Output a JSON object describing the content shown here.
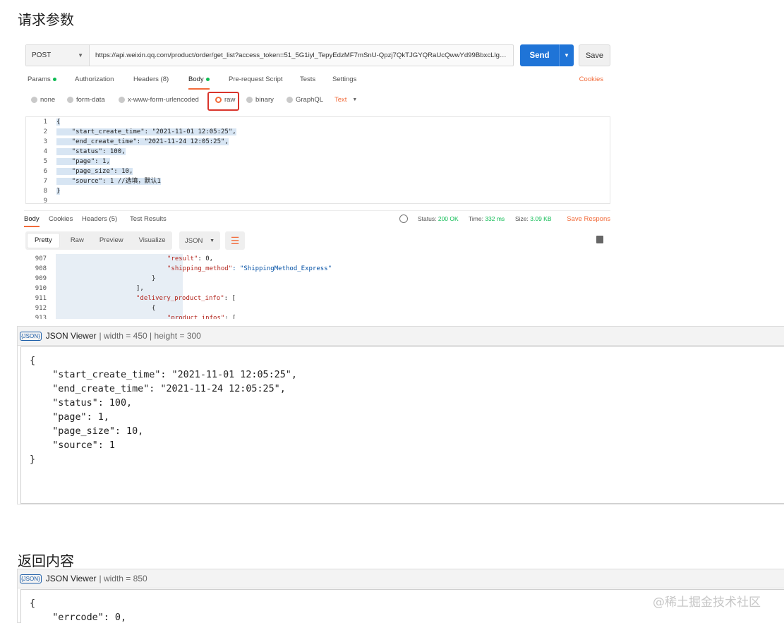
{
  "sections": {
    "request_title": "请求参数",
    "response_title": "返回内容"
  },
  "postman": {
    "method": "POST",
    "url": "https://api.weixin.qq.com/product/order/get_list?access_token=51_5G1iyl_TepyEdzMF7mSnU-Qpzj7QkTJGYQRaUcQwwYd99BbxcLlgV ...",
    "send_label": "Send",
    "save_label": "Save",
    "request_tabs": [
      "Params",
      "Authorization",
      "Headers (8)",
      "Body",
      "Pre-request Script",
      "Tests",
      "Settings"
    ],
    "cookies_label": "Cookies",
    "body_options": [
      "none",
      "form-data",
      "x-www-form-urlencoded",
      "raw",
      "binary",
      "GraphQL"
    ],
    "body_format": "Text",
    "editor_lines": [
      "{",
      "    \"start_create_time\": \"2021-11-01 12:05:25\",",
      "    \"end_create_time\": \"2021-11-24 12:05:25\",",
      "    \"status\": 100,",
      "    \"page\": 1,",
      "    \"page_size\": 10,",
      "    \"source\": 1 //选填，默认1",
      "}",
      ""
    ],
    "editor_line_numbers": [
      "1",
      "2",
      "3",
      "4",
      "5",
      "6",
      "7",
      "8",
      "9"
    ],
    "response_tabs": [
      "Body",
      "Cookies",
      "Headers (5)",
      "Test Results"
    ],
    "status_label": "Status:",
    "status_value": "200 OK",
    "time_label": "Time:",
    "time_value": "332 ms",
    "size_label": "Size:",
    "size_value": "3.09 KB",
    "save_response": "Save Respons",
    "view_modes": [
      "Pretty",
      "Raw",
      "Preview",
      "Visualize"
    ],
    "view_format": "JSON",
    "response_line_numbers": [
      "907",
      "908",
      "909",
      "910",
      "911",
      "912",
      "913"
    ],
    "response_lines": [
      {
        "key": "\"result\"",
        "rest": ": 0,",
        "type": "num"
      },
      {
        "key": "\"shipping_method\"",
        "rest": ": \"ShippingMethod_Express\"",
        "type": "str"
      },
      {
        "key": "",
        "rest": "}",
        "type": ""
      },
      {
        "key": "",
        "rest": "],",
        "type": ""
      },
      {
        "key": "\"delivery_product_info\"",
        "rest": ": [",
        "type": ""
      },
      {
        "key": "",
        "rest": "{",
        "type": ""
      },
      {
        "key": "\"product_infos\"",
        "rest": ": [",
        "type": ""
      }
    ]
  },
  "json_viewer_1": {
    "title": "JSON Viewer",
    "meta": "| width = 450 | height = 300",
    "lines": [
      "{",
      "    \"start_create_time\": \"2021-11-01 12:05:25\",",
      "    \"end_create_time\": \"2021-11-24 12:05:25\",",
      "    \"status\": 100,",
      "    \"page\": 1,",
      "    \"page_size\": 10,",
      "    \"source\": 1",
      "}"
    ]
  },
  "json_viewer_2": {
    "title": "JSON Viewer",
    "meta": "| width = 850",
    "lines": [
      "{",
      "    \"errcode\": 0,"
    ]
  },
  "icon_label": "{JSON}",
  "watermark": "@稀土掘金技术社区",
  "colors": {
    "accent": "#f26b3a",
    "send_blue": "#1f74d7",
    "green": "#0cbb52",
    "highlight_red": "#d9342b"
  }
}
